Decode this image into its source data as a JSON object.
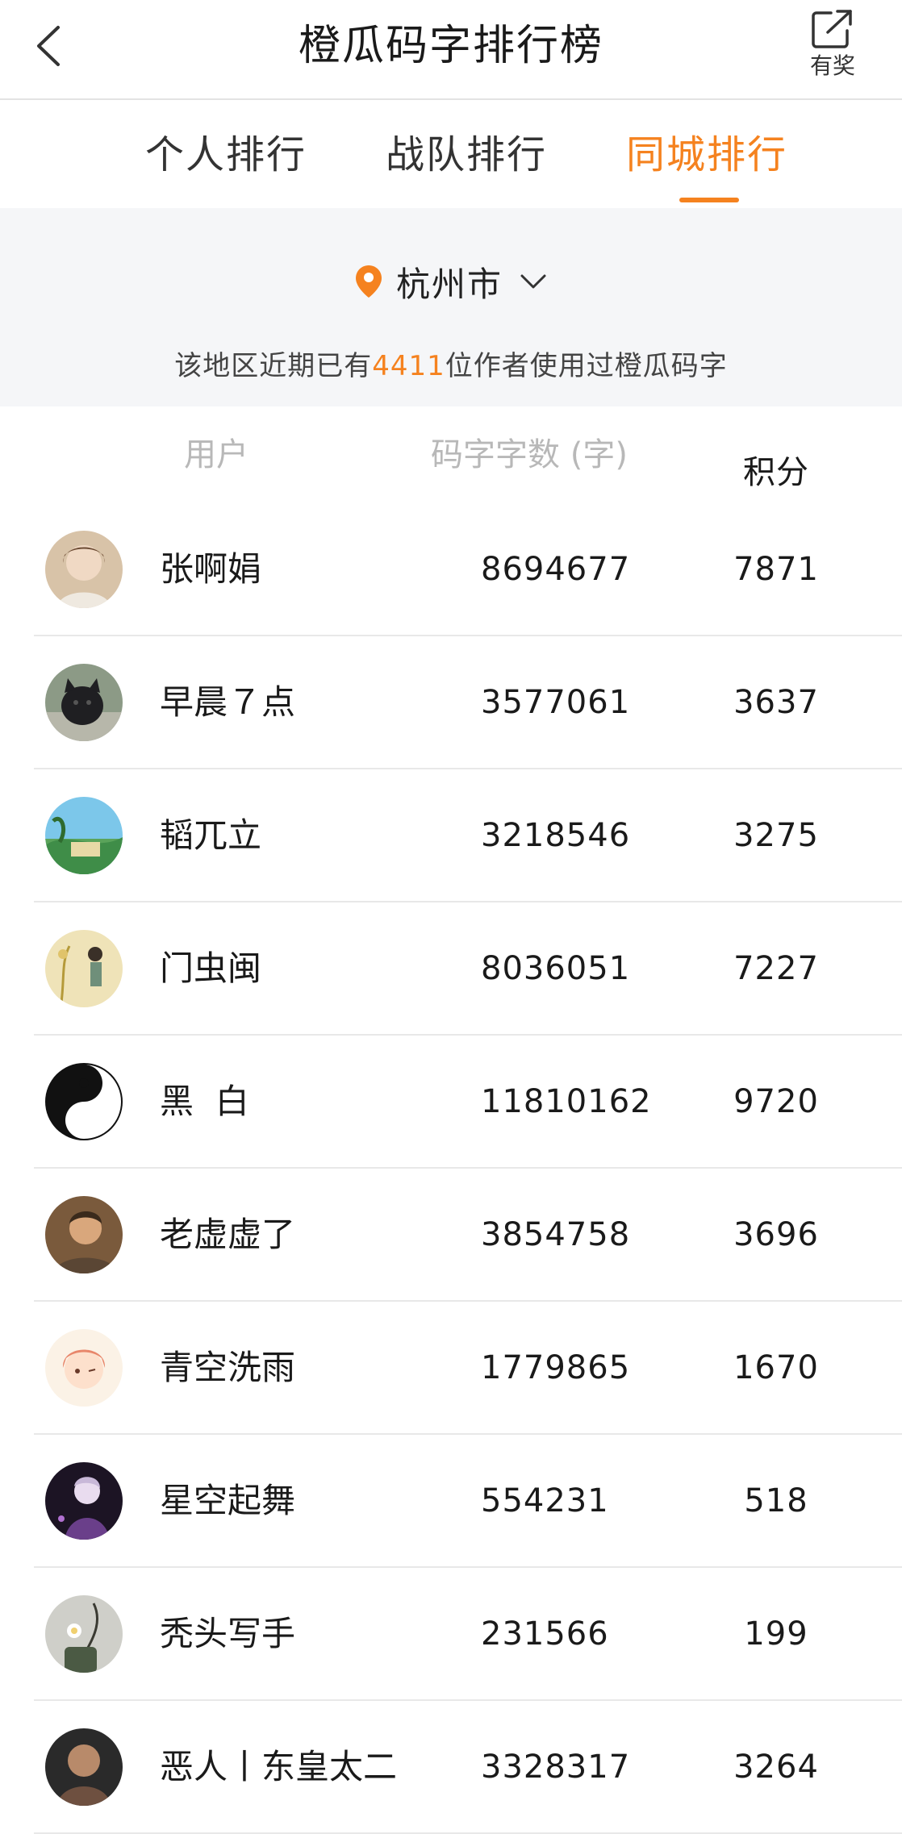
{
  "header": {
    "title": "橙瓜码字排行榜",
    "share_label": "有奖"
  },
  "tabs": [
    {
      "label": "个人排行",
      "active": false
    },
    {
      "label": "战队排行",
      "active": false
    },
    {
      "label": "同城排行",
      "active": true
    }
  ],
  "city": {
    "name": "杭州市",
    "info_prefix": "该地区近期已有",
    "author_count": "4411",
    "info_suffix": "位作者使用过橙瓜码字"
  },
  "columns": {
    "user": "用户",
    "words": "码字字数 (字)",
    "score": "积分"
  },
  "colors": {
    "accent": "#f5821f",
    "text": "#1a1a1a",
    "muted": "#b8b8b8",
    "panel_bg": "#f5f6f8"
  },
  "rows": [
    {
      "name": "张啊娟",
      "words": "8694677",
      "score": "7871",
      "avatar": "portrait-avatar"
    },
    {
      "name": "早晨７点",
      "words": "3577061",
      "score": "3637",
      "avatar": "dog-avatar"
    },
    {
      "name": "韬兀立",
      "words": "3218546",
      "score": "3275",
      "avatar": "landscape-avatar"
    },
    {
      "name": "门虫闽",
      "words": "8036051",
      "score": "7227",
      "avatar": "illustration-avatar"
    },
    {
      "name": "黑  白",
      "words": "11810162",
      "score": "9720",
      "avatar": "yin-yang-avatar"
    },
    {
      "name": "老虚虚了",
      "words": "3854758",
      "score": "3696",
      "avatar": "portrait-avatar"
    },
    {
      "name": "青空洗雨",
      "words": "1779865",
      "score": "1670",
      "avatar": "anime-avatar"
    },
    {
      "name": "星空起舞",
      "words": "554231",
      "score": "518",
      "avatar": "anime-dark-avatar"
    },
    {
      "name": "秃头写手",
      "words": "231566",
      "score": "199",
      "avatar": "flower-avatar"
    },
    {
      "name": "恶人丨东皇太二",
      "words": "3328317",
      "score": "3264",
      "avatar": "portrait-avatar"
    }
  ]
}
